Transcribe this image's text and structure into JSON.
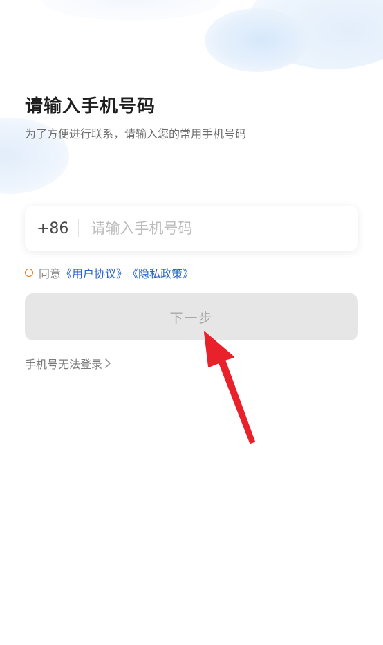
{
  "header": {
    "title": "请输入手机号码",
    "subtitle": "为了方便进行联系，请输入您的常用手机号码"
  },
  "phone": {
    "country_code": "+86",
    "placeholder": "请输入手机号码",
    "value": ""
  },
  "agreement": {
    "checked": false,
    "prefix": "同意",
    "user_agreement": "《用户协议》",
    "privacy_policy": "《隐私政策》"
  },
  "actions": {
    "next_label": "下一步",
    "cant_login_label": "手机号无法登录"
  },
  "icons": {
    "agree_radio": "radio-unchecked-icon",
    "cant_login_chevron": "chevron-right-icon",
    "annotation": "red-arrow-icon"
  },
  "colors": {
    "link": "#2a66c9",
    "radio_border": "#e07a1f",
    "button_disabled_bg": "#e6e6e6",
    "button_disabled_text": "#a8a8a8",
    "arrow": "#e8212b"
  }
}
